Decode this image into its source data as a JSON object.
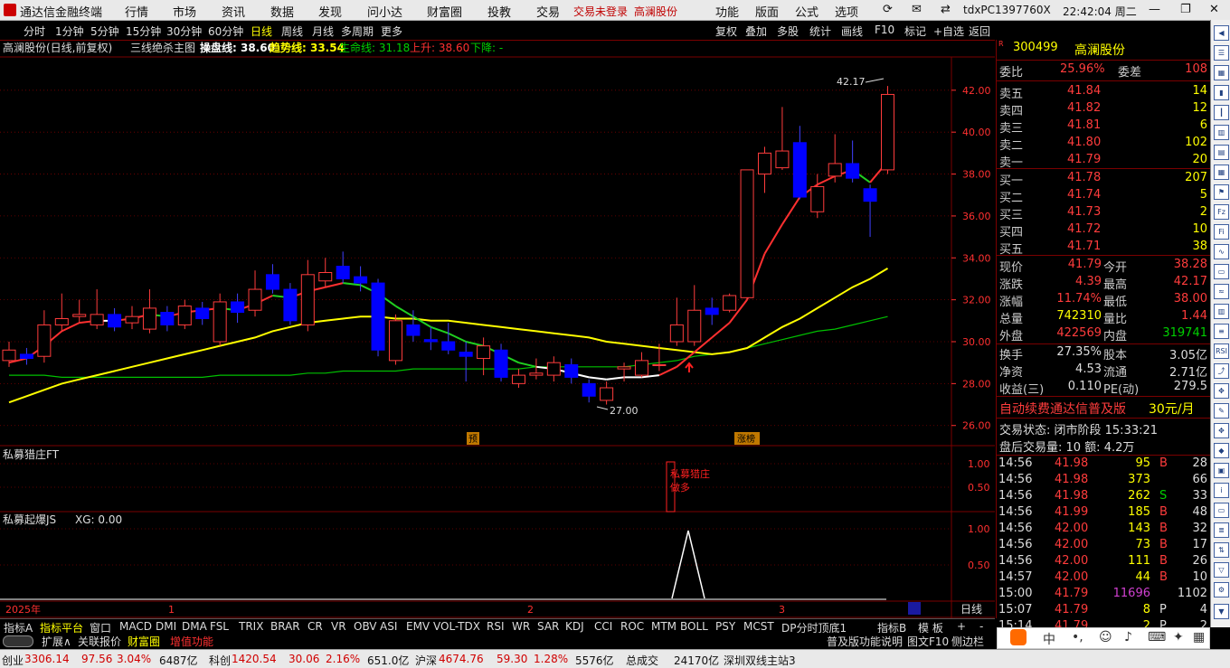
{
  "app_title": "通达信金融终端",
  "menu": [
    "行情",
    "市场",
    "资讯",
    "数据",
    "发现",
    "问小达",
    "财富圈",
    "投教",
    "交易"
  ],
  "login_status": "交易未登录",
  "login_stock": "高澜股份",
  "right_menu": [
    "功能",
    "版面",
    "公式",
    "选项"
  ],
  "machine": "tdxPC1397760X",
  "clock": "22:42:04 周二",
  "periods": [
    "分时",
    "1分钟",
    "5分钟",
    "15分钟",
    "30分钟",
    "60分钟",
    "日线",
    "周线",
    "月线",
    "多周期",
    "更多"
  ],
  "active_period": "日线",
  "right_tools": [
    "复权",
    "叠加",
    "多股",
    "统计",
    "画线",
    "F10",
    "标记",
    "+自选",
    "返回"
  ],
  "chart_title": "高澜股份(日线,前复权)",
  "indicator_name": "三线绝杀主图",
  "ind_labels": {
    "czx": "操盘线: 38.60",
    "qsx": "趋势线: 33.54",
    "smx": "生命线: 31.18",
    "up": "上升: 38.60",
    "down": "下降: -"
  },
  "sub1_title": "私募猎庄FT",
  "sub1_annot": [
    "私募猎庄",
    "做多"
  ],
  "sub2_title": "私募起爆JS",
  "sub2_value": "XG: 0.00",
  "chart_marks": {
    "high_label": "42.17",
    "low_label": "27.00",
    "pre_tag": "预",
    "zt_tag": "涨榜"
  },
  "x_axis": {
    "year": "2025年",
    "m1": "1",
    "m2": "2",
    "m3": "3",
    "period_label": "日线"
  },
  "colors": {
    "up": "#ff3c3c",
    "down": "#0000ff",
    "ma1": "#ff3030",
    "ma_white": "#ffffff",
    "ma2": "#ffff00",
    "ma3": "#00c000",
    "grid": "#7a0000"
  },
  "chart_data": {
    "type": "candlestick",
    "y_ticks": [
      42.0,
      40.0,
      38.0,
      36.0,
      34.0,
      32.0,
      30.0,
      28.0,
      26.0
    ],
    "ylim": [
      25.6,
      43.2
    ],
    "sub1_ticks": [
      1.0,
      0.5
    ],
    "sub2_ticks": [
      1.0,
      0.5
    ],
    "candles": [
      {
        "o": 29.1,
        "c": 29.6,
        "h": 30.0,
        "l": 28.8
      },
      {
        "o": 29.4,
        "c": 29.2,
        "h": 29.7,
        "l": 28.9
      },
      {
        "o": 29.3,
        "c": 30.8,
        "h": 31.5,
        "l": 29.0
      },
      {
        "o": 30.8,
        "c": 31.1,
        "h": 32.3,
        "l": 30.5
      },
      {
        "o": 31.2,
        "c": 31.3,
        "h": 32.0,
        "l": 30.9
      },
      {
        "o": 30.8,
        "c": 31.3,
        "h": 32.5,
        "l": 30.6
      },
      {
        "o": 31.3,
        "c": 30.7,
        "h": 31.6,
        "l": 30.5
      },
      {
        "o": 30.9,
        "c": 31.2,
        "h": 31.7,
        "l": 30.6
      },
      {
        "o": 30.6,
        "c": 31.6,
        "h": 32.5,
        "l": 30.4
      },
      {
        "o": 31.4,
        "c": 30.8,
        "h": 31.7,
        "l": 30.5
      },
      {
        "o": 30.8,
        "c": 31.7,
        "h": 32.0,
        "l": 30.6
      },
      {
        "o": 31.6,
        "c": 31.1,
        "h": 31.9,
        "l": 30.8
      },
      {
        "o": 30.0,
        "c": 31.9,
        "h": 32.3,
        "l": 29.8
      },
      {
        "o": 31.9,
        "c": 31.4,
        "h": 32.3,
        "l": 30.9
      },
      {
        "o": 31.5,
        "c": 32.5,
        "h": 33.4,
        "l": 31.2
      },
      {
        "o": 33.2,
        "c": 32.5,
        "h": 33.7,
        "l": 32.3
      },
      {
        "o": 32.5,
        "c": 31.0,
        "h": 32.8,
        "l": 30.8
      },
      {
        "o": 30.8,
        "c": 33.2,
        "h": 33.9,
        "l": 30.5
      },
      {
        "o": 32.9,
        "c": 33.3,
        "h": 34.0,
        "l": 32.6
      },
      {
        "o": 33.6,
        "c": 33.0,
        "h": 34.3,
        "l": 32.8
      },
      {
        "o": 33.1,
        "c": 32.8,
        "h": 33.6,
        "l": 32.4
      },
      {
        "o": 32.8,
        "c": 29.6,
        "h": 33.0,
        "l": 29.3
      },
      {
        "o": 29.1,
        "c": 31.0,
        "h": 31.3,
        "l": 28.9
      },
      {
        "o": 30.8,
        "c": 30.3,
        "h": 31.5,
        "l": 30.0
      },
      {
        "o": 30.1,
        "c": 30.0,
        "h": 30.7,
        "l": 29.6
      },
      {
        "o": 30.0,
        "c": 29.6,
        "h": 30.9,
        "l": 29.4
      },
      {
        "o": 29.5,
        "c": 29.3,
        "h": 30.0,
        "l": 28.1
      },
      {
        "o": 29.2,
        "c": 29.8,
        "h": 30.2,
        "l": 28.4
      },
      {
        "o": 29.6,
        "c": 28.3,
        "h": 29.9,
        "l": 28.1
      },
      {
        "o": 28.0,
        "c": 28.4,
        "h": 28.7,
        "l": 27.8
      },
      {
        "o": 28.4,
        "c": 28.5,
        "h": 29.2,
        "l": 28.2
      },
      {
        "o": 28.4,
        "c": 29.0,
        "h": 29.3,
        "l": 28.1
      },
      {
        "o": 28.9,
        "c": 28.3,
        "h": 29.2,
        "l": 28.0
      },
      {
        "o": 28.0,
        "c": 27.4,
        "h": 28.2,
        "l": 27.1
      },
      {
        "o": 27.2,
        "c": 27.8,
        "h": 28.1,
        "l": 27.0
      },
      {
        "o": 28.7,
        "c": 28.8,
        "h": 29.0,
        "l": 28.1
      },
      {
        "o": 28.4,
        "c": 29.1,
        "h": 29.5,
        "l": 28.3
      },
      {
        "o": 28.9,
        "c": 28.9,
        "h": 29.9,
        "l": 28.6
      },
      {
        "o": 30.0,
        "c": 30.8,
        "h": 32.1,
        "l": 29.8
      },
      {
        "o": 30.0,
        "c": 31.5,
        "h": 32.7,
        "l": 29.8
      },
      {
        "o": 31.6,
        "c": 31.3,
        "h": 32.1,
        "l": 30.8
      },
      {
        "o": 31.5,
        "c": 32.2,
        "h": 32.3,
        "l": 31.4
      },
      {
        "o": 32.1,
        "c": 38.2,
        "h": 38.2,
        "l": 32.0
      },
      {
        "o": 38.0,
        "c": 39.0,
        "h": 39.3,
        "l": 37.1
      },
      {
        "o": 38.3,
        "c": 39.1,
        "h": 41.2,
        "l": 38.2
      },
      {
        "o": 39.5,
        "c": 36.9,
        "h": 40.3,
        "l": 36.8
      },
      {
        "o": 36.2,
        "c": 37.4,
        "h": 38.0,
        "l": 35.9
      },
      {
        "o": 37.9,
        "c": 38.5,
        "h": 39.9,
        "l": 37.6
      },
      {
        "o": 38.5,
        "c": 37.8,
        "h": 39.6,
        "l": 37.6
      },
      {
        "o": 37.3,
        "c": 36.7,
        "h": 37.5,
        "l": 35.0
      },
      {
        "o": 38.2,
        "c": 41.8,
        "h": 42.2,
        "l": 38.0
      }
    ],
    "ma_main": [
      29.0,
      29.2,
      29.8,
      30.5,
      30.9,
      31.0,
      31.0,
      31.1,
      31.3,
      31.2,
      31.4,
      31.5,
      31.6,
      31.5,
      31.8,
      32.2,
      32.1,
      32.4,
      32.6,
      32.8,
      32.7,
      32.3,
      31.7,
      31.2,
      30.7,
      30.4,
      30.0,
      29.8,
      29.4,
      29.0,
      28.8,
      28.7,
      28.5,
      28.3,
      28.2,
      28.3,
      28.3,
      28.4,
      28.8,
      29.5,
      30.2,
      30.9,
      32.0,
      34.2,
      35.6,
      36.9,
      37.5,
      37.9,
      38.2,
      37.6,
      38.6
    ],
    "ma_mid": [
      27.1,
      27.4,
      27.7,
      28.0,
      28.2,
      28.4,
      28.6,
      28.8,
      29.0,
      29.2,
      29.4,
      29.6,
      29.8,
      30.0,
      30.2,
      30.5,
      30.7,
      30.9,
      31.0,
      31.1,
      31.2,
      31.2,
      31.1,
      31.1,
      31.0,
      31.0,
      30.9,
      30.8,
      30.7,
      30.6,
      30.5,
      30.4,
      30.3,
      30.2,
      30.0,
      29.9,
      29.8,
      29.7,
      29.6,
      29.5,
      29.4,
      29.5,
      29.7,
      30.2,
      30.7,
      31.1,
      31.6,
      32.1,
      32.6,
      33.0,
      33.5
    ],
    "ma_long": [
      28.4,
      28.4,
      28.4,
      28.3,
      28.3,
      28.3,
      28.3,
      28.3,
      28.3,
      28.3,
      28.3,
      28.3,
      28.4,
      28.4,
      28.4,
      28.4,
      28.4,
      28.5,
      28.5,
      28.6,
      28.6,
      28.6,
      28.6,
      28.7,
      28.7,
      28.7,
      28.7,
      28.7,
      28.7,
      28.7,
      28.8,
      28.8,
      28.8,
      28.8,
      28.8,
      28.8,
      28.9,
      29.0,
      29.1,
      29.3,
      29.4,
      29.5,
      29.7,
      29.9,
      30.1,
      30.3,
      30.5,
      30.6,
      30.8,
      31.0,
      31.2
    ]
  },
  "quote": {
    "code": "300499",
    "name": "高澜股份",
    "weibi_label": "委比",
    "weibi": "25.96%",
    "weicha_label": "委差",
    "weicha": "108",
    "asks": [
      {
        "label": "卖五",
        "price": "41.84",
        "vol": "14"
      },
      {
        "label": "卖四",
        "price": "41.82",
        "vol": "12"
      },
      {
        "label": "卖三",
        "price": "41.81",
        "vol": "6"
      },
      {
        "label": "卖二",
        "price": "41.80",
        "vol": "102"
      },
      {
        "label": "卖一",
        "price": "41.79",
        "vol": "20"
      }
    ],
    "bids": [
      {
        "label": "买一",
        "price": "41.78",
        "vol": "207"
      },
      {
        "label": "买二",
        "price": "41.74",
        "vol": "5"
      },
      {
        "label": "买三",
        "price": "41.73",
        "vol": "2"
      },
      {
        "label": "买四",
        "price": "41.72",
        "vol": "10"
      },
      {
        "label": "买五",
        "price": "41.71",
        "vol": "38"
      }
    ],
    "stats": [
      {
        "l1": "现价",
        "v1": "41.79",
        "c1": "red",
        "l2": "今开",
        "v2": "38.28",
        "c2": "red"
      },
      {
        "l1": "涨跌",
        "v1": "4.39",
        "c1": "red",
        "l2": "最高",
        "v2": "42.17",
        "c2": "red"
      },
      {
        "l1": "涨幅",
        "v1": "11.74%",
        "c1": "red",
        "l2": "最低",
        "v2": "38.00",
        "c2": "red"
      },
      {
        "l1": "总量",
        "v1": "742310",
        "c1": "yellow",
        "l2": "量比",
        "v2": "1.44",
        "c2": "red"
      },
      {
        "l1": "外盘",
        "v1": "422569",
        "c1": "red",
        "l2": "内盘",
        "v2": "319741",
        "c2": "green"
      }
    ],
    "stats2": [
      {
        "l1": "换手",
        "v1": "27.35%",
        "l2": "股本",
        "v2": "3.05亿"
      },
      {
        "l1": "净资",
        "v1": "4.53",
        "l2": "流通",
        "v2": "2.71亿"
      },
      {
        "l1": "收益(三)",
        "v1": "0.110",
        "l2": "PE(动)",
        "v2": "279.5"
      }
    ],
    "promo": "自动续费通达信普及版",
    "promo_price": "30元/月",
    "trade_state": "交易状态: 闭市阶段 15:33:21",
    "after_hours": "盘后交易量: 10  额: 4.2万",
    "ticks": [
      {
        "t": "14:56",
        "p": "41.98",
        "v": "95",
        "d": "B",
        "n": "28"
      },
      {
        "t": "14:56",
        "p": "41.98",
        "v": "373",
        "d": "",
        "n": "66"
      },
      {
        "t": "14:56",
        "p": "41.98",
        "v": "262",
        "d": "S",
        "n": "33"
      },
      {
        "t": "14:56",
        "p": "41.99",
        "v": "185",
        "d": "B",
        "n": "48"
      },
      {
        "t": "14:56",
        "p": "42.00",
        "v": "143",
        "d": "B",
        "n": "32"
      },
      {
        "t": "14:56",
        "p": "42.00",
        "v": "73",
        "d": "B",
        "n": "17"
      },
      {
        "t": "14:56",
        "p": "42.00",
        "v": "111",
        "d": "B",
        "n": "26"
      },
      {
        "t": "14:57",
        "p": "42.00",
        "v": "44",
        "d": "B",
        "n": "10"
      },
      {
        "t": "15:00",
        "p": "41.79",
        "v": "11696",
        "d": "",
        "n": "1102"
      },
      {
        "t": "15:07",
        "p": "41.79",
        "v": "8",
        "d": "P",
        "n": "4"
      },
      {
        "t": "15:14",
        "p": "41.79",
        "v": "2",
        "d": "P",
        "n": "2"
      }
    ]
  },
  "tabs": [
    "指标A",
    "指标平台",
    "窗口",
    "MACD",
    "DMI",
    "DMA",
    "FSL",
    "TRIX",
    "BRAR",
    "CR",
    "VR",
    "OBV",
    "ASI",
    "EMV",
    "VOL-TDX",
    "RSI",
    "WR",
    "SAR",
    "KDJ",
    "CCI",
    "ROC",
    "MTM",
    "BOLL",
    "PSY",
    "MCST",
    "DP分时顶底1",
    "指标B",
    "模 板",
    "+",
    "-"
  ],
  "bottom_tabs": [
    "扩展∧",
    "关联报价",
    "财富圈",
    "增值功能"
  ],
  "bottom_right": [
    "普及版功能说明",
    "图文F10",
    "侧边栏"
  ],
  "ime": [
    "中",
    "•,"
  ],
  "status": {
    "cy_label": "创业",
    "cy_val": "3306.14",
    "cy_chg": "97.56",
    "cy_pct": "3.04%",
    "cy_amt": "6487亿",
    "kc_label": "科创",
    "kc_val": "1420.54",
    "kc_chg": "30.06",
    "kc_pct": "2.16%",
    "kc_amt": "651.0亿",
    "hs_label": "沪深",
    "hs_val": "4674.76",
    "hs_chg": "59.30",
    "hs_pct": "1.28%",
    "hs_amt": "5576亿",
    "total_label": "总成交",
    "total_val": "24170亿",
    "server": "深圳双线主站3"
  }
}
